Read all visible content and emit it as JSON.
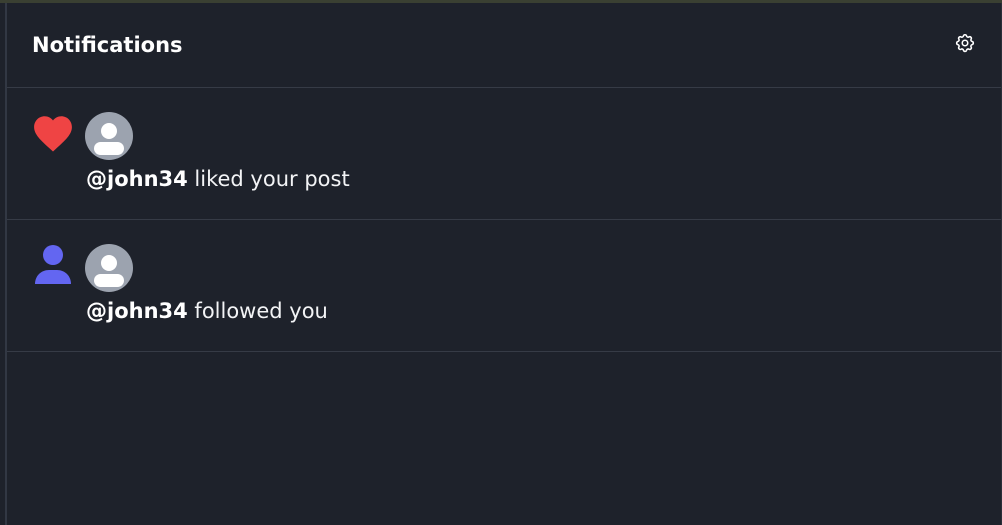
{
  "panel": {
    "title": "Notifications",
    "settings_icon": "gear-icon"
  },
  "notifications": [
    {
      "type_icon": "heart-icon",
      "type_color": "#ef4444",
      "avatar_icon": "user-avatar-icon",
      "username": "@john34",
      "message": " liked your post"
    },
    {
      "type_icon": "person-icon",
      "type_color": "#6366f1",
      "avatar_icon": "user-avatar-icon",
      "username": "@john34",
      "message": " followed you"
    }
  ],
  "colors": {
    "background": "#1e222b",
    "divider": "#363b46",
    "avatar": "#9ca3af",
    "text": "#f3f4f6"
  }
}
